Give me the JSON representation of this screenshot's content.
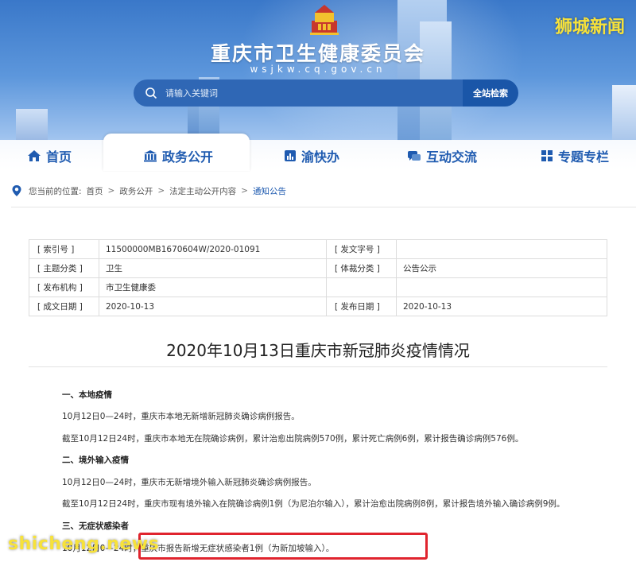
{
  "header": {
    "site_title": "重庆市卫生健康委员会",
    "site_url": "wsjkw.cq.gov.cn",
    "watermark": "狮城新闻"
  },
  "search": {
    "placeholder": "请输入关键词",
    "button_label": "全站检索"
  },
  "nav": {
    "items": [
      {
        "label": "首页",
        "icon": "home-icon"
      },
      {
        "label": "政务公开",
        "icon": "building-icon",
        "active": true
      },
      {
        "label": "渝快办",
        "icon": "chart-icon"
      },
      {
        "label": "互动交流",
        "icon": "chat-icon"
      },
      {
        "label": "专题专栏",
        "icon": "grid-icon"
      }
    ]
  },
  "breadcrumb": {
    "prefix": "您当前的位置:",
    "items": [
      "首页",
      "政务公开",
      "法定主动公开内容",
      "通知公告"
    ]
  },
  "meta": {
    "rows": [
      {
        "k1": "[ 索引号 ]",
        "v1": "11500000MB1670604W/2020-01091",
        "k2": "[ 发文字号 ]",
        "v2": ""
      },
      {
        "k1": "[ 主题分类 ]",
        "v1": "卫生",
        "k2": "[ 体裁分类 ]",
        "v2": "公告公示"
      },
      {
        "k1": "[ 发布机构 ]",
        "v1": "市卫生健康委",
        "k2": "",
        "v2": ""
      },
      {
        "k1": "[ 成文日期 ]",
        "v1": "2020-10-13",
        "k2": "[ 发布日期 ]",
        "v2": "2020-10-13"
      }
    ]
  },
  "article": {
    "title": "2020年10月13日重庆市新冠肺炎疫情情况",
    "sec1_heading": "一、本地疫情",
    "sec1_p1": "10月12日0—24时，重庆市本地无新增新冠肺炎确诊病例报告。",
    "sec1_p2": "截至10月12日24时，重庆市本地无在院确诊病例，累计治愈出院病例570例，累计死亡病例6例，累计报告确诊病例576例。",
    "sec2_heading": "二、境外输入疫情",
    "sec2_p1": "10月12日0—24时，重庆市无新增境外输入新冠肺炎确诊病例报告。",
    "sec2_p2": "截至10月12日24时，重庆市现有境外输入在院确诊病例1例（为尼泊尔输入），累计治愈出院病例8例，累计报告境外输入确诊病例9例。",
    "sec3_heading": "三、无症状感染者",
    "sec3_p1_prefix": "10月12日0—24时，",
    "sec3_p1_highlight": "重庆市报告新增无症状感染者1例（为新加坡输入）。"
  },
  "watermark_bottom": "shicheng.news",
  "colors": {
    "brand_blue": "#1f5bb0",
    "highlight_red": "#e0242e",
    "watermark_yellow": "#f7e23a"
  }
}
